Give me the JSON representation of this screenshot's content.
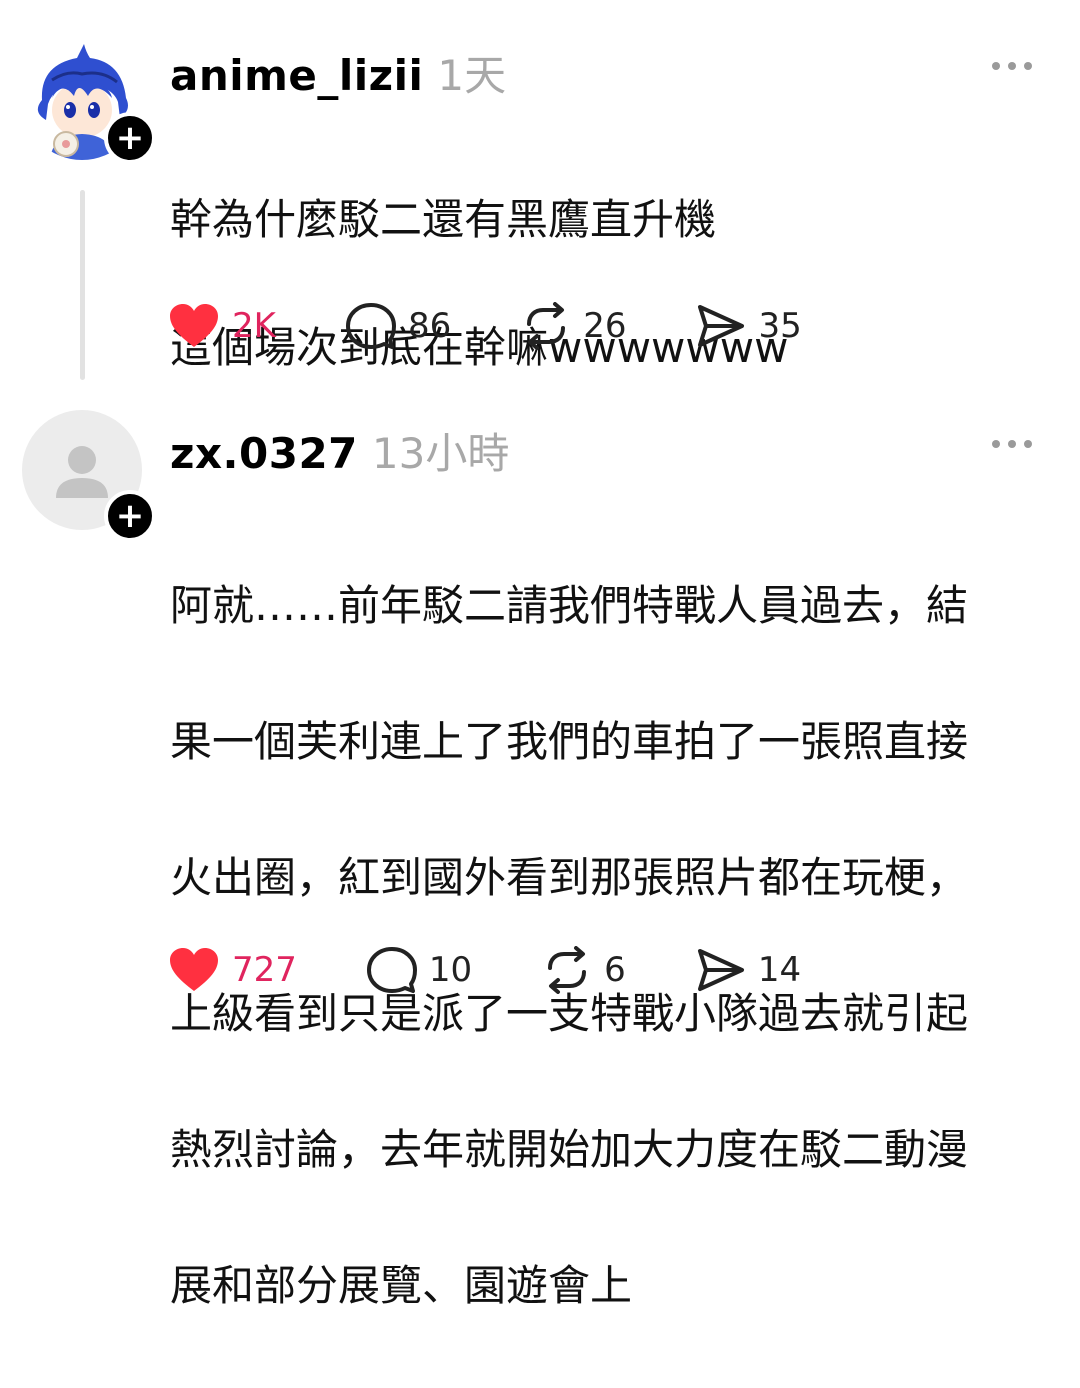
{
  "colors": {
    "like": "#ff3040",
    "muted": "#a8a8a8",
    "text": "#000000"
  },
  "posts": [
    {
      "username": "anime_lizii",
      "timestamp": "1天",
      "lines": [
        "幹為什麼駁二還有黑鷹直升機",
        "這個場次到底在幹嘛wwwwwww"
      ],
      "likes": "2K",
      "replies": "86",
      "reposts": "26",
      "shares": "35",
      "avatar_icon": "anime-character-avatar-icon"
    },
    {
      "username": "zx.0327",
      "timestamp": "13小時",
      "lines": [
        "阿就……前年駁二請我們特戰人員過去，結",
        "果一個芙利連上了我們的車拍了一張照直接",
        "火出圈，紅到國外看到那張照片都在玩梗，",
        "上級看到只是派了一支特戰小隊過去就引起",
        "熱烈討論，去年就開始加大力度在駁二動漫",
        "展和部分展覽、園遊會上"
      ],
      "likes": "727",
      "replies": "10",
      "reposts": "6",
      "shares": "14",
      "avatar_icon": "default-person-avatar-icon"
    }
  ]
}
